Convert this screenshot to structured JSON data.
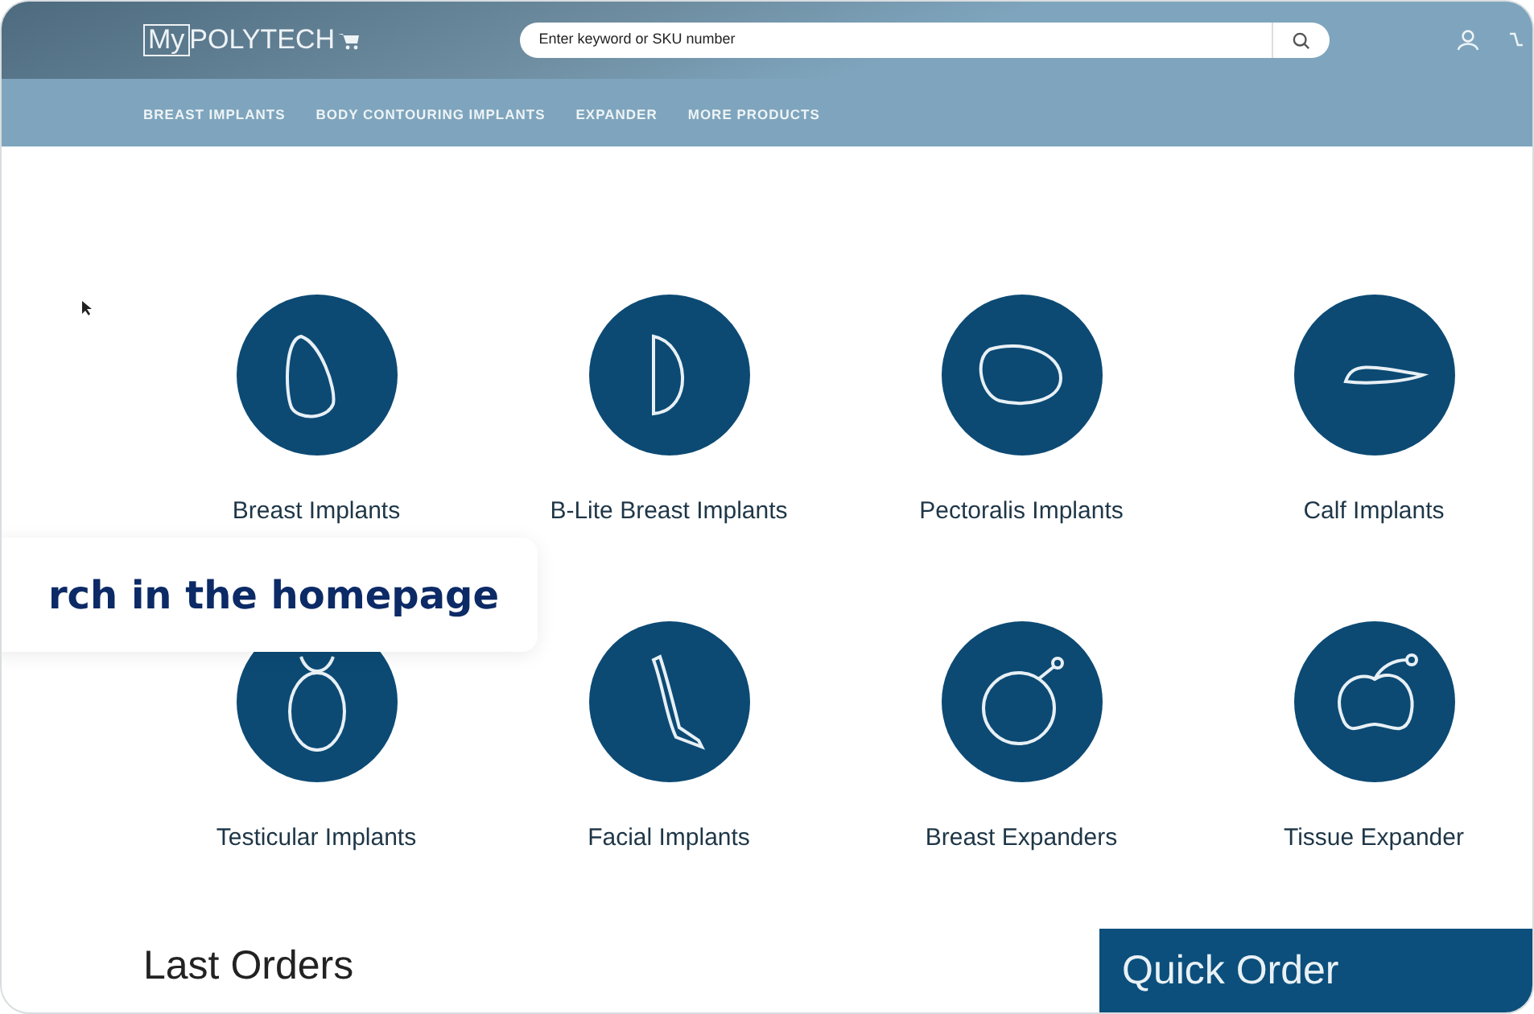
{
  "header": {
    "logo": {
      "boxed": "My",
      "rest": "POLYTECH"
    },
    "search": {
      "placeholder": "Enter keyword or SKU number"
    },
    "nav": [
      "BREAST IMPLANTS",
      "BODY CONTOURING IMPLANTS",
      "EXPANDER",
      "MORE PRODUCTS"
    ]
  },
  "categories": [
    {
      "label": "Breast Implants",
      "kind": "teardrop"
    },
    {
      "label": "B-Lite Breast Implants",
      "kind": "dome"
    },
    {
      "label": "Pectoralis Implants",
      "kind": "oval"
    },
    {
      "label": "Calf Implants",
      "kind": "wedge"
    },
    {
      "label": "Testicular Implants",
      "kind": "ellipse"
    },
    {
      "label": "Facial Implants",
      "kind": "chin"
    },
    {
      "label": "Breast Expanders",
      "kind": "ring"
    },
    {
      "label": "Tissue Expander",
      "kind": "kidney"
    }
  ],
  "callout": "rch in the homepage",
  "last_orders": {
    "title": "Last Orders"
  },
  "quick_order": {
    "title": "Quick Order"
  }
}
